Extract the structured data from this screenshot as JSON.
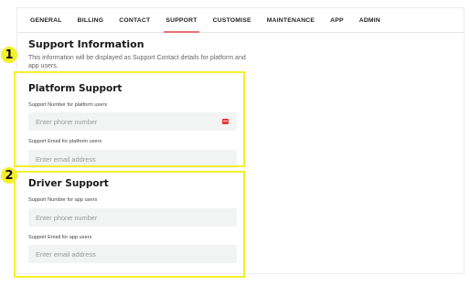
{
  "tabs": [
    {
      "label": "GENERAL"
    },
    {
      "label": "BILLING"
    },
    {
      "label": "CONTACT"
    },
    {
      "label": "SUPPORT",
      "active": true
    },
    {
      "label": "CUSTOMISE"
    },
    {
      "label": "MAINTENANCE"
    },
    {
      "label": "APP"
    },
    {
      "label": "ADMIN"
    }
  ],
  "section": {
    "title": "Support Information",
    "description": "This information will be displayed as Support Contact details for platform and app users."
  },
  "platform": {
    "title": "Platform Support",
    "number_label": "Support Number for platform users",
    "number_placeholder": "Enter phone number",
    "email_label": "Support Email for platform users",
    "email_placeholder": "Enter email address"
  },
  "driver": {
    "title": "Driver Support",
    "number_label": "Support Number for app users",
    "number_placeholder": "Enter phone number",
    "email_label": "Support Email for app users",
    "email_placeholder": "Enter email address"
  },
  "badges": {
    "one": "1",
    "two": "2"
  },
  "colors": {
    "highlight": "#f4f02a",
    "active_tab_underline": "#e57373",
    "input_bg": "#f2f3f3"
  },
  "icons": {
    "phone_country": "flag-icon"
  }
}
